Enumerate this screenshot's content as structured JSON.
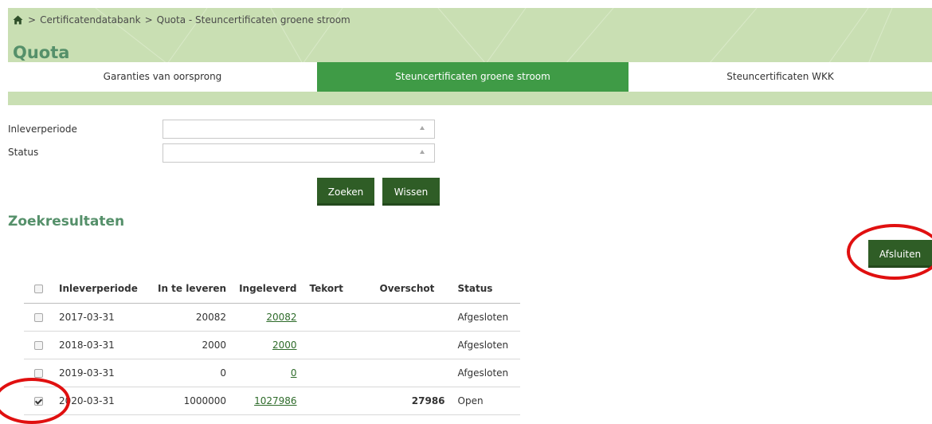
{
  "breadcrumb": {
    "home_icon": "home-icon",
    "separator": ">",
    "items": [
      "Certificatendatabank",
      "Quota - Steuncertificaten groene stroom"
    ]
  },
  "page_title": "Quota",
  "tabs": [
    {
      "label": "Garanties van oorsprong",
      "active": false
    },
    {
      "label": "Steuncertificaten groene stroom",
      "active": true
    },
    {
      "label": "Steuncertificaten WKK",
      "active": false
    }
  ],
  "filters": {
    "inleverperiode_label": "Inleverperiode",
    "inleverperiode_value": "",
    "status_label": "Status",
    "status_value": ""
  },
  "buttons": {
    "search": "Zoeken",
    "clear": "Wissen",
    "close": "Afsluiten"
  },
  "results": {
    "title": "Zoekresultaten",
    "columns": [
      "Inleverperiode",
      "In te leveren",
      "Ingeleverd",
      "Tekort",
      "Overschot",
      "Status"
    ],
    "rows": [
      {
        "checked": false,
        "inleverperiode": "2017-03-31",
        "in_te_leveren": "20082",
        "ingeleverd": "20082",
        "tekort": "",
        "overschot": "",
        "status": "Afgesloten"
      },
      {
        "checked": false,
        "inleverperiode": "2018-03-31",
        "in_te_leveren": "2000",
        "ingeleverd": "2000",
        "tekort": "",
        "overschot": "",
        "status": "Afgesloten"
      },
      {
        "checked": false,
        "inleverperiode": "2019-03-31",
        "in_te_leveren": "0",
        "ingeleverd": "0",
        "tekort": "",
        "overschot": "",
        "status": "Afgesloten"
      },
      {
        "checked": true,
        "inleverperiode": "2020-03-31",
        "in_te_leveren": "1000000",
        "ingeleverd": "1027986",
        "tekort": "",
        "overschot": "27986",
        "status": "Open"
      }
    ]
  },
  "colors": {
    "header_bg": "#c9dfb3",
    "active_tab": "#3f9b46",
    "button": "#2f5d26",
    "title": "#55906a",
    "annotation": "#e01010"
  }
}
